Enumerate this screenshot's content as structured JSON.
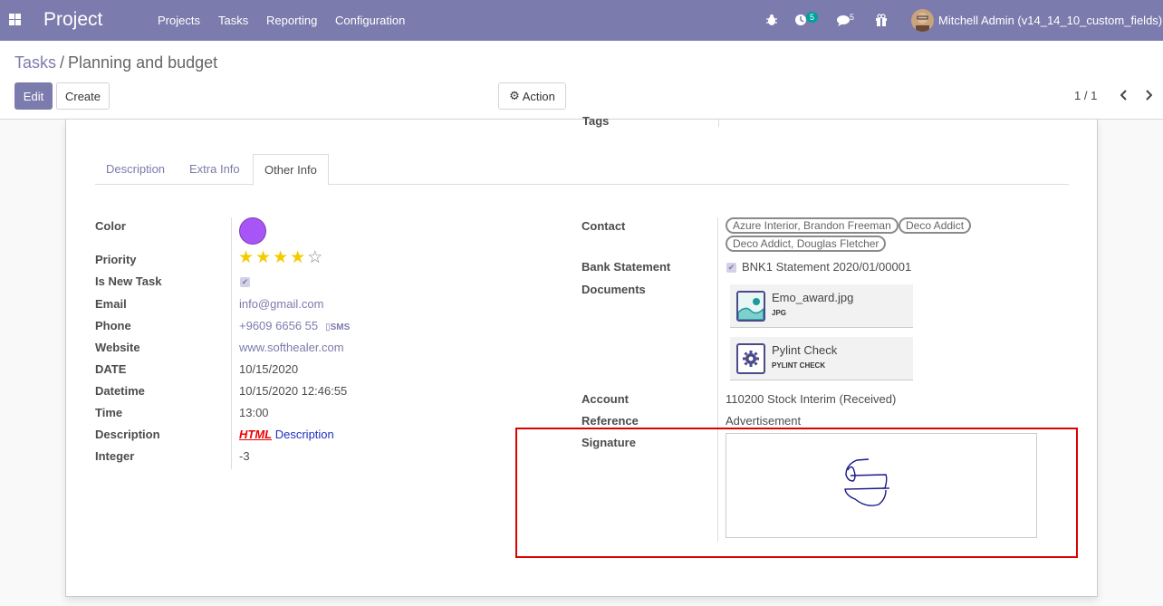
{
  "navbar": {
    "brand": "Project",
    "menu": [
      "Projects",
      "Tasks",
      "Reporting",
      "Configuration"
    ],
    "activity_count": "5",
    "messages_count": "5",
    "user": "Mitchell Admin (v14_14_10_custom_fields)",
    "bg_color": "#7c7bad"
  },
  "breadcrumb": {
    "parent": "Tasks",
    "separator": "/",
    "current": "Planning and budget"
  },
  "buttons": {
    "edit": "Edit",
    "create": "Create",
    "action": "Action"
  },
  "pager": {
    "value": "1 / 1"
  },
  "sheet": {
    "tags_label": "Tags",
    "tabs": [
      "Description",
      "Extra Info",
      "Other Info"
    ],
    "active_tab": "Other Info",
    "left": {
      "color_label": "Color",
      "color_value": "#a855f7",
      "priority_label": "Priority",
      "priority_stars": 4,
      "priority_max": 5,
      "is_new_task_label": "Is New Task",
      "is_new_task": true,
      "email_label": "Email",
      "email": "info@gmail.com",
      "phone_label": "Phone",
      "phone": "+9609 6656 55",
      "sms": "SMS",
      "website_label": "Website",
      "website": "www.softhealer.com",
      "date_label": "DATE",
      "date": "10/15/2020",
      "datetime_label": "Datetime",
      "datetime": "10/15/2020 12:46:55",
      "time_label": "Time",
      "time": "13:00",
      "description_label": "Description",
      "description_html": "HTML",
      "description_text": "Description",
      "integer_label": "Integer",
      "integer": "-3"
    },
    "right": {
      "contact_label": "Contact",
      "contacts": [
        "Azure Interior, Brandon Freeman",
        "Deco Addict",
        "Deco Addict, Douglas Fletcher"
      ],
      "bank_statement_label": "Bank Statement",
      "bank_statement": "BNK1 Statement 2020/01/00001",
      "documents_label": "Documents",
      "documents": [
        {
          "name": "Emo_award.jpg",
          "type": "JPG",
          "icon": "image-icon"
        },
        {
          "name": "Pylint Check",
          "type": "PYLINT CHECK",
          "icon": "gear-icon"
        }
      ],
      "account_label": "Account",
      "account": "110200 Stock Interim (Received)",
      "reference_label": "Reference",
      "reference": "Advertisement",
      "signature_label": "Signature"
    }
  }
}
